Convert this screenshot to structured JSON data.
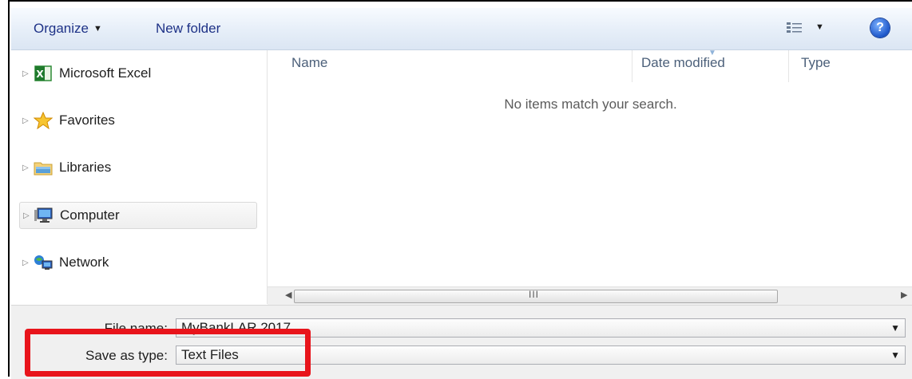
{
  "toolbar": {
    "organize_label": "Organize",
    "new_folder_label": "New folder",
    "view_icon": "view-options-icon",
    "help_icon": "help-icon",
    "help_glyph": "?"
  },
  "nav": {
    "items": [
      {
        "label": "Microsoft Excel",
        "icon": "excel-icon"
      },
      {
        "label": "Favorites",
        "icon": "star-icon"
      },
      {
        "label": "Libraries",
        "icon": "library-folder-icon"
      },
      {
        "label": "Computer",
        "icon": "computer-icon"
      },
      {
        "label": "Network",
        "icon": "network-icon"
      }
    ],
    "selected_index": 3
  },
  "content": {
    "columns": [
      "Name",
      "Date modified",
      "Type"
    ],
    "empty_message": "No items match your search."
  },
  "scrollbar": {
    "grip": "III"
  },
  "form": {
    "file_name_label": "File name:",
    "file_name_value": "MyBankLAR 2017",
    "save_type_label": "Save as type:",
    "save_type_value": "Text Files"
  },
  "colors": {
    "highlight": "#e8141b",
    "link": "#1e3287"
  }
}
